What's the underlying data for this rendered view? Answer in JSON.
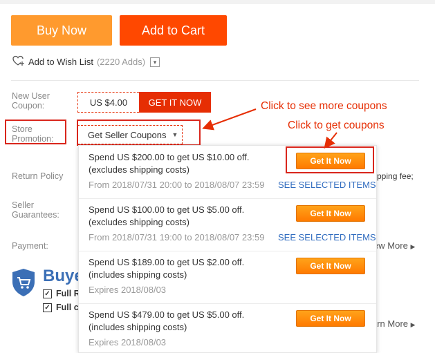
{
  "actions": {
    "buy_now": "Buy Now",
    "add_to_cart": "Add to Cart"
  },
  "wishlist": {
    "label": "Add to Wish List",
    "count": "(2220 Adds)",
    "toggle_icon": "chevron-down-icon"
  },
  "new_user": {
    "label_line1": "New User",
    "label_line2": "Coupon:",
    "amount": "US $4.00",
    "button": "GET IT NOW"
  },
  "store_promo": {
    "label_line1": "Store",
    "label_line2": "Promotion:",
    "dropdown": "Get Seller Coupons"
  },
  "annotations": {
    "more_coupons": "Click to see more coupons",
    "get_coupons": "Click to get coupons",
    "color": "#e62e04"
  },
  "rows": {
    "return_policy": "Return Policy",
    "seller_guarantees_1": "Seller",
    "seller_guarantees_2": "Guarantees:",
    "payment": "Payment:",
    "shipping_fee_fragment": "pping fee;",
    "view_more": "ew More",
    "learn_more": "arn More"
  },
  "buyer_protection": {
    "title": "Buye",
    "item1": "Full R",
    "item2": "Full c"
  },
  "coupons": [
    {
      "line1": "Spend US $200.00 to get US $10.00 off.",
      "line2": "(excludes shipping costs)",
      "line3": "From 2018/07/31 20:00 to 2018/08/07 23:59",
      "link": "SEE SELECTED ITEMS",
      "button": "Get It Now"
    },
    {
      "line1": "Spend US $100.00 to get US $5.00 off.",
      "line2": "(excludes shipping costs)",
      "line3": "From 2018/07/31 19:00 to 2018/08/07 23:59",
      "link": "SEE SELECTED ITEMS",
      "button": "Get It Now"
    },
    {
      "line1": "Spend US $189.00 to get US $2.00 off.",
      "line2": "(includes shipping costs)",
      "line3": "Expires 2018/08/03",
      "link": "",
      "button": "Get It Now"
    },
    {
      "line1": "Spend US $479.00 to get US $5.00 off.",
      "line2": "(includes shipping costs)",
      "line3": "Expires 2018/08/03",
      "link": "",
      "button": "Get It Now"
    }
  ],
  "colors": {
    "buy_now": "#ff9a2e",
    "add_to_cart": "#ff4800",
    "coupon_red": "#e62e04",
    "link_blue": "#2f6bbf",
    "get_orange": "#ff8c0a"
  }
}
